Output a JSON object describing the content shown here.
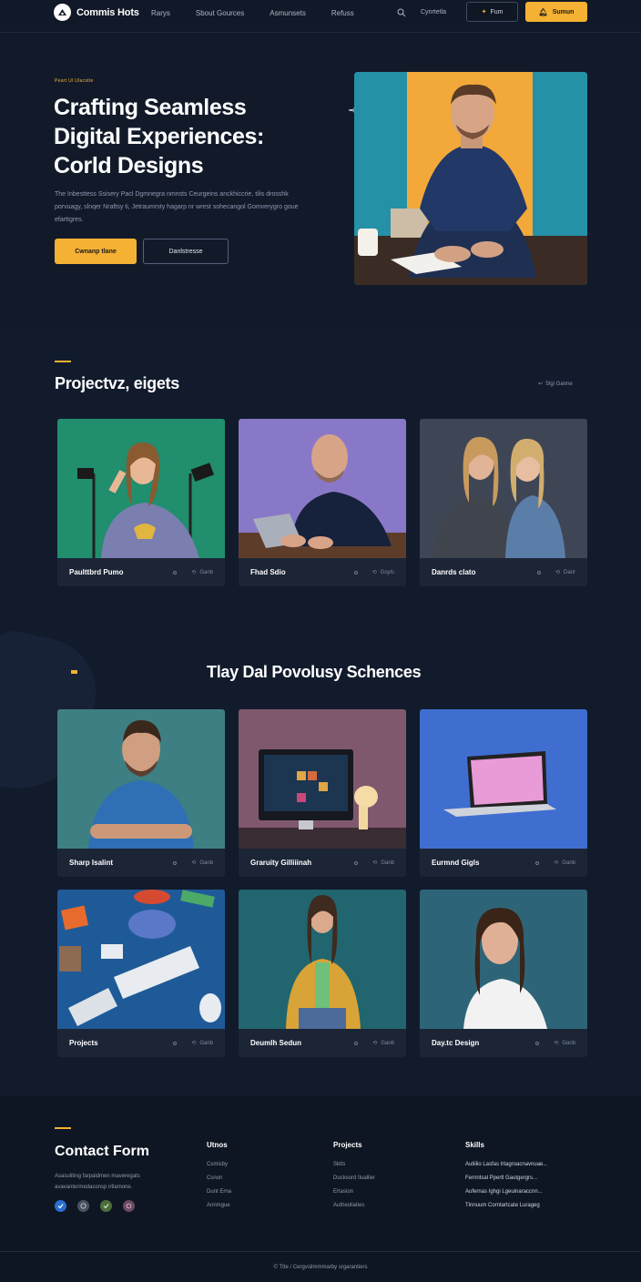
{
  "nav": {
    "brand": "Commis Hots",
    "links": [
      "Rarys",
      "Sbout Gources",
      "Asmunsets",
      "Refuss"
    ],
    "profile_label": "Cynrtetla",
    "outline_button": "Fum",
    "solid_button": "Sumun"
  },
  "hero": {
    "eyebrow": "Peart Ul Ulacstte",
    "title": "Crafting Seamless\nDigital Experiences:\nCorld Designs",
    "description": "The Inbesttess Ssisery Pacl Dgmnegra nmnsts Ceurgeins anckhiccrie, tilis drosshk porvuagy, slnqer Nraftsy ti, Jetraumrsty hagarp nr wrest sohecangol Gomverygro goue efarttgres.",
    "primary_button": "Cwnanp tlane",
    "secondary_button": "Danlstresse"
  },
  "projects": {
    "title": "Projectvz, eigets",
    "view_all": "Slgi Ganne",
    "cards": [
      {
        "title": "Paulttbrd Pumo",
        "meta": "Ganb"
      },
      {
        "title": "Fhad Sdio",
        "meta": "Goyls"
      },
      {
        "title": "Danrds clato",
        "meta": "Danr"
      }
    ]
  },
  "services": {
    "title": "Tlay Dal Povolusy Schences",
    "cards": [
      {
        "title": "Sharp Isalint",
        "meta": "Ganb"
      },
      {
        "title": "Graruity Gilliiinah",
        "meta": "Ganb"
      },
      {
        "title": "Eurmnd Gigls",
        "meta": "Ganb"
      },
      {
        "title": "Projects",
        "meta": "Ganb"
      },
      {
        "title": "Deumlh Sedun",
        "meta": "Ganb"
      },
      {
        "title": "Day.tc Design",
        "meta": "Ganb"
      }
    ]
  },
  "footer": {
    "title": "Contact Form",
    "description": "Asasuliting farpaldmen maveregats avavantermedaconsp irtlamone.",
    "columns": [
      {
        "heading": "Utnos",
        "items": [
          "Csmisby",
          "Csnon",
          "Dunt Erna",
          "Annmgue"
        ]
      },
      {
        "heading": "Projects",
        "items": [
          "Sktts",
          "Ducksord Iluallier",
          "Ertasion",
          "Autheoliaties"
        ]
      },
      {
        "heading": "Skills",
        "items": [
          "Autiilio Lasfas Irtagroacnavnuae...",
          "Fernntsal Ppertl Gautgergrs...",
          "Aufernas Ighgi Lgeuinaraccnn...",
          "Tlnnuum Corntartcate Lurageg"
        ]
      }
    ],
    "copyright": "© Ttte / Cergvsilmmmarby srgarantiers"
  },
  "colors": {
    "accent": "#f5b133",
    "background": "#121a2a",
    "card": "#1c2536"
  }
}
